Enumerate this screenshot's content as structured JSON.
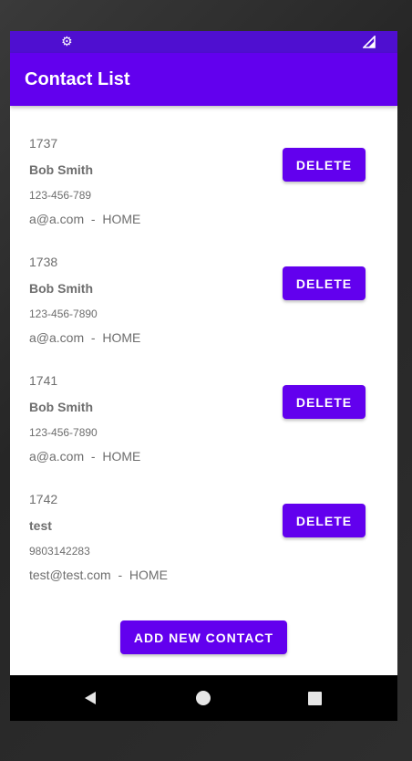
{
  "status_bar": {
    "left_icon": "gear-icon",
    "right_icon": "signal-icon"
  },
  "app_bar": {
    "title": "Contact List",
    "color": "#6200ee"
  },
  "contacts": [
    {
      "id": "1737",
      "name": "Bob Smith",
      "phone": "123-456-789",
      "email": "a@a.com",
      "separator": "  -  ",
      "type": "HOME",
      "delete_label": "DELETE"
    },
    {
      "id": "1738",
      "name": "Bob Smith",
      "phone": "123-456-7890",
      "email": "a@a.com",
      "separator": "  -  ",
      "type": "HOME",
      "delete_label": "DELETE"
    },
    {
      "id": "1741",
      "name": "Bob Smith",
      "phone": "123-456-7890",
      "email": "a@a.com",
      "separator": "  -  ",
      "type": "HOME",
      "delete_label": "DELETE"
    },
    {
      "id": "1742",
      "name": "test",
      "phone": "9803142283",
      "email": "test@test.com",
      "separator": "  -  ",
      "type": "HOME",
      "delete_label": "DELETE"
    }
  ],
  "add_button": {
    "label": "ADD NEW CONTACT"
  },
  "nav_bar": {
    "back_icon": "back-triangle-icon",
    "home_icon": "home-circle-icon",
    "recents_icon": "recents-square-icon"
  }
}
